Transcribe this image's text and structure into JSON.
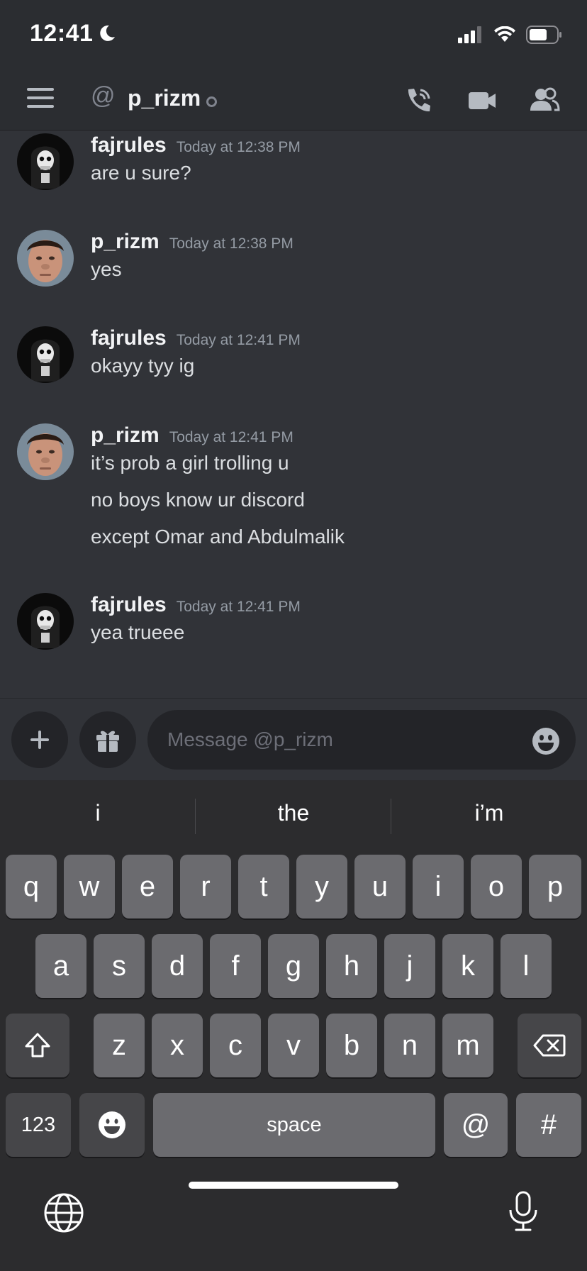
{
  "status_bar": {
    "time": "12:41"
  },
  "header": {
    "at_symbol": "@",
    "channel_name": "p_rizm"
  },
  "messages": [
    {
      "user": "fajrules",
      "timestamp": "Today at 12:38 PM",
      "lines": [
        "are u sure?"
      ]
    },
    {
      "user": "p_rizm",
      "timestamp": "Today at 12:38 PM",
      "lines": [
        "yes"
      ]
    },
    {
      "user": "fajrules",
      "timestamp": "Today at 12:41 PM",
      "lines": [
        "okayy tyy ig"
      ]
    },
    {
      "user": "p_rizm",
      "timestamp": "Today at 12:41 PM",
      "lines": [
        "it’s prob a girl trolling u",
        "no boys know ur discord",
        "except Omar and Abdulmalik"
      ]
    },
    {
      "user": "fajrules",
      "timestamp": "Today at 12:41 PM",
      "lines": [
        "yea trueee"
      ]
    }
  ],
  "composer": {
    "placeholder": "Message @p_rizm",
    "add_label": "+"
  },
  "keyboard": {
    "suggestions": [
      "i",
      "the",
      "i’m"
    ],
    "row1": [
      "q",
      "w",
      "e",
      "r",
      "t",
      "y",
      "u",
      "i",
      "o",
      "p"
    ],
    "row2": [
      "a",
      "s",
      "d",
      "f",
      "g",
      "h",
      "j",
      "k",
      "l"
    ],
    "row3": [
      "z",
      "x",
      "c",
      "v",
      "b",
      "n",
      "m"
    ],
    "numbers_label": "123",
    "space_label": "space",
    "at_label": "@",
    "hash_label": "#"
  },
  "colors": {
    "background": "#313338",
    "header": "#2b2d31",
    "keyboard": "#2c2c2e",
    "key": "#6b6b6f",
    "key_dark": "#464649"
  }
}
